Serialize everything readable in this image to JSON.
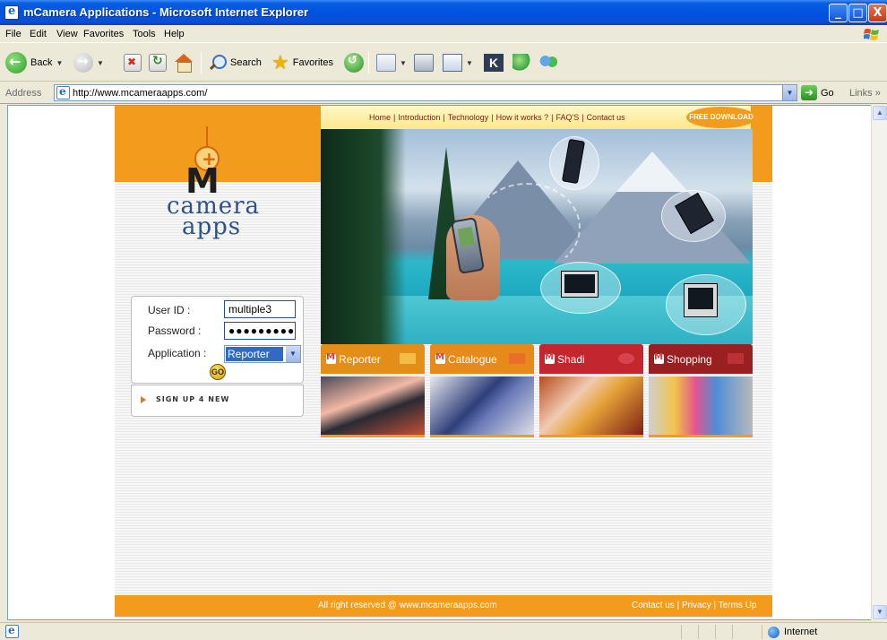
{
  "window": {
    "title": "mCamera Applications - Microsoft Internet Explorer",
    "controls": {
      "minimize": "_",
      "maximize": "□",
      "close": "X"
    }
  },
  "menu": {
    "items": [
      "File",
      "Edit",
      "View",
      "Favorites",
      "Tools",
      "Help"
    ]
  },
  "toolbar": {
    "back_label": "Back",
    "search_label": "Search",
    "favorites_label": "Favorites"
  },
  "address": {
    "label": "Address",
    "url": "http://www.mcameraapps.com/",
    "go_label": "Go",
    "links_label": "Links",
    "links_chevron": "»"
  },
  "page": {
    "logo": {
      "m": "M",
      "line1": "camera",
      "line2": "apps"
    },
    "nav": {
      "links": [
        "Home",
        "|",
        "Introduction",
        "|",
        "Technology",
        "|",
        "How it works ?",
        "|",
        "FAQ'S",
        "|",
        "Contact us"
      ],
      "free_download": "FREE DOWNLOAD"
    },
    "login": {
      "user_label": "User ID :",
      "user_value": "multiple3",
      "password_label": "Password :",
      "password_mask": "●●●●●●●●●",
      "application_label": "Application :",
      "application_value": "Reporter",
      "go_label": "GO"
    },
    "signup": "SIGN UP 4 NEW",
    "tabs": [
      "Reporter",
      "Catalogue",
      "Shadi",
      "Shopping"
    ],
    "footer": {
      "copyright": "All right reserved @ www.mcameraapps.com",
      "links": "Contact us | Privacy | Terms Up"
    }
  },
  "status": {
    "zone": "Internet"
  }
}
